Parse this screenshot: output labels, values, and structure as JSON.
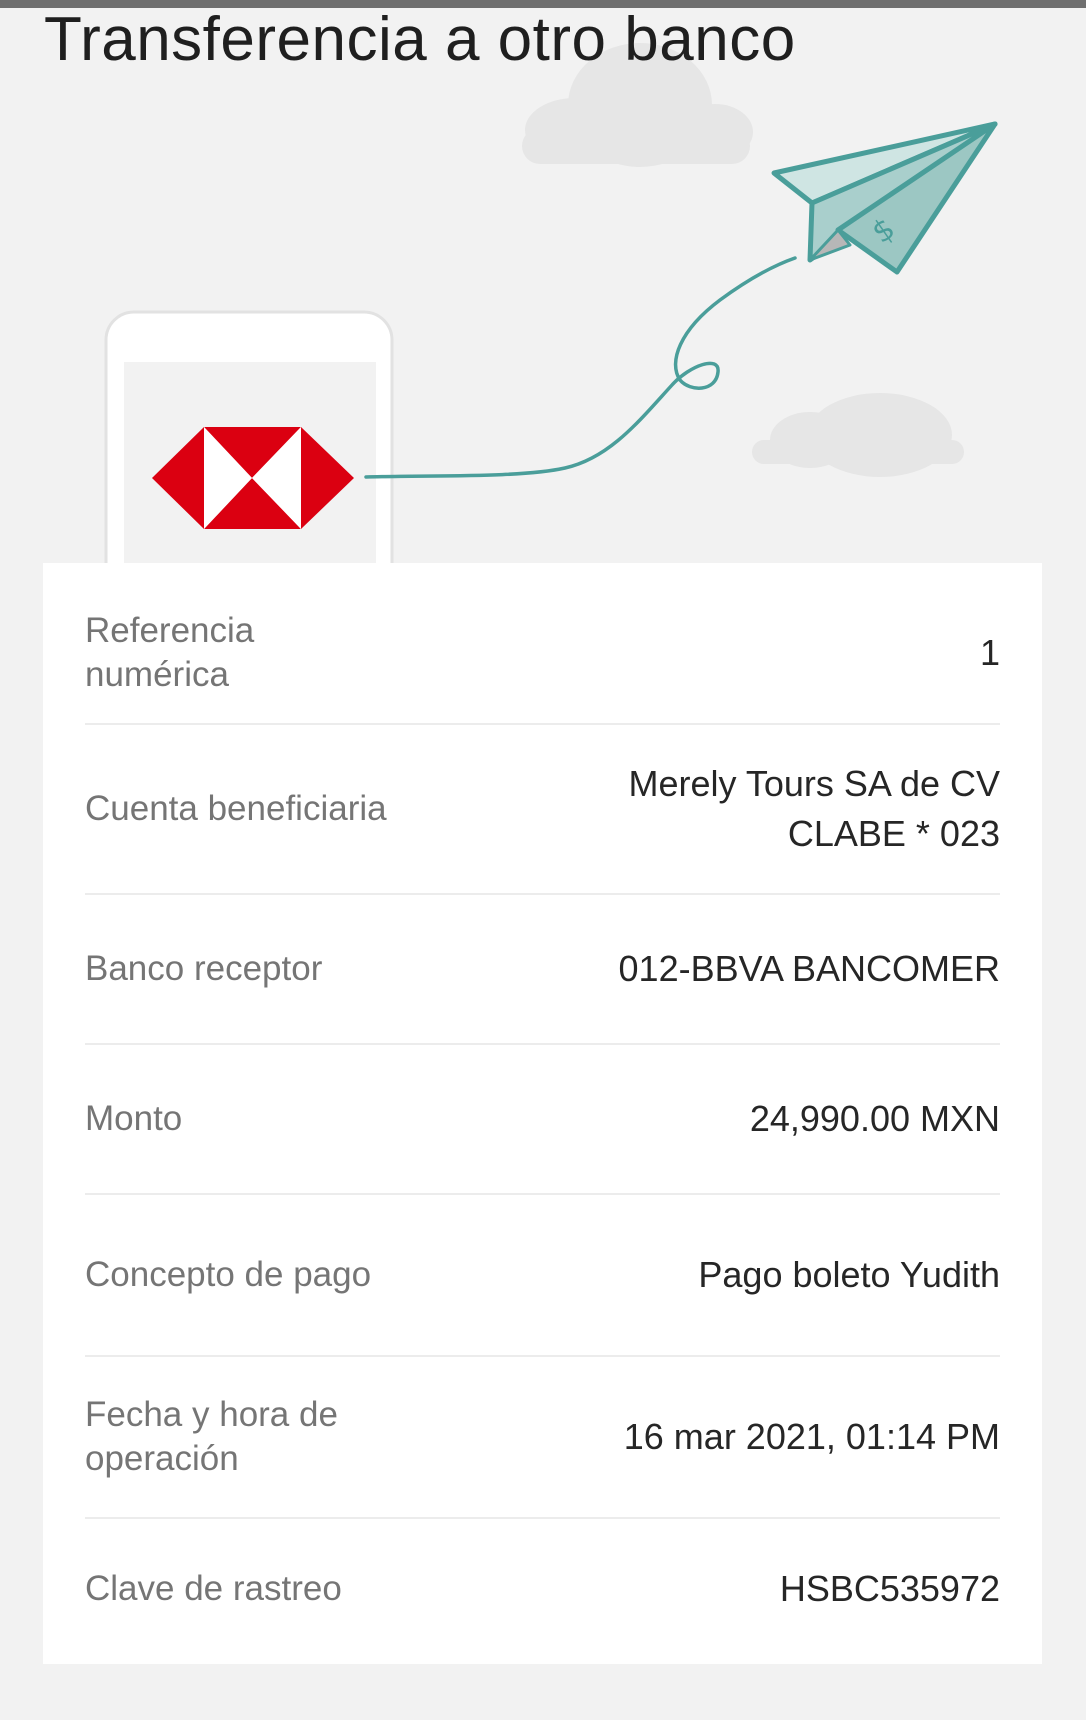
{
  "header": {
    "title": "Transferencia a otro banco"
  },
  "illustration": {
    "logo": "HSBC hexagon logo",
    "plane_icon": "paper-plane-icon",
    "colors": {
      "logo_red": "#db0011",
      "plane_teal": "#4a9e9a",
      "cloud": "#e3e3e3"
    }
  },
  "details": [
    {
      "label": "Referencia numérica",
      "value": "1"
    },
    {
      "label": "Cuenta beneficiaria",
      "value": "Merely Tours SA de CV",
      "value2": "CLABE * 023"
    },
    {
      "label": "Banco receptor",
      "value": "012-BBVA BANCOMER"
    },
    {
      "label": "Monto",
      "value": "24,990.00 MXN"
    },
    {
      "label": "Concepto de pago",
      "value": "Pago boleto Yudith"
    },
    {
      "label": "Fecha y hora de operación",
      "value": "16 mar 2021, 01:14 PM"
    },
    {
      "label": "Clave de rastreo",
      "value": "HSBC535972"
    }
  ]
}
